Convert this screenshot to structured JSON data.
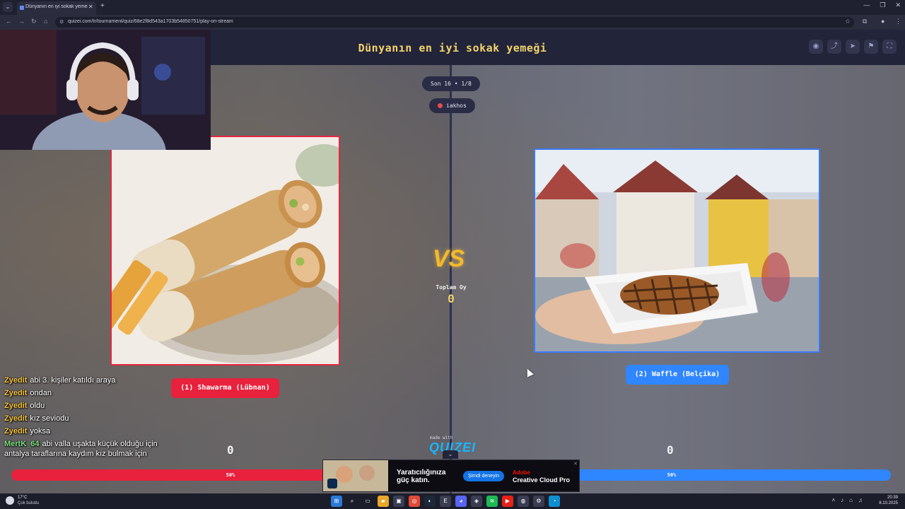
{
  "browser": {
    "tab_title": "Dünyanın en iyi sokak yemeği",
    "tab_close": "✕",
    "new_tab": "+",
    "url": "quizei.com/tr/tournament/quiz/68e2f8d543a1703b54850751/play-on-stream",
    "window_controls": [
      "—",
      "❐",
      "✕"
    ]
  },
  "page": {
    "title": "Dünyanın en iyi sokak yemeği",
    "round": "Son 16 • 1/8",
    "user": "iakhos",
    "vs": "VS",
    "total_label": "Toplam Oy",
    "total_value": "0",
    "made_with": "made with",
    "brand": "QUIZEI"
  },
  "left_choice": {
    "label": "(1) Shawarma (Lübnan)",
    "votes": "0",
    "percent": 50,
    "percent_label": "50%",
    "color": "#e8213d"
  },
  "right_choice": {
    "label": "(2) Waffle (Belçika)",
    "votes": "0",
    "percent": 50,
    "percent_label": "50%",
    "color": "#2f86ff"
  },
  "chat": [
    {
      "user": "Zyedit",
      "color": "#f3c13a",
      "message": "abi 3. kişiler katıldı araya"
    },
    {
      "user": "Zyedit",
      "color": "#f3c13a",
      "message": "ondan"
    },
    {
      "user": "Zyedit",
      "color": "#f3c13a",
      "message": "oldu"
    },
    {
      "user": "Zyedit",
      "color": "#f3c13a",
      "message": "kız seviodu"
    },
    {
      "user": "Zyedit",
      "color": "#f3c13a",
      "message": "yoksa"
    },
    {
      "user": "MertK_64",
      "color": "#7ae07a",
      "message": "abi valla uşakta küçük olduğu için antalya taraflarına kaydım kız bulmak için"
    }
  ],
  "ad": {
    "headline": "Yaratıcılığınıza güç katın.",
    "cta": "Şimdi deneyin",
    "brand": "Adobe",
    "product": "Creative Cloud Pro"
  },
  "taskbar": {
    "temperature": "17°C",
    "weather": "Çok bulutlu",
    "time": "20:39",
    "date": "8.10.2025"
  }
}
